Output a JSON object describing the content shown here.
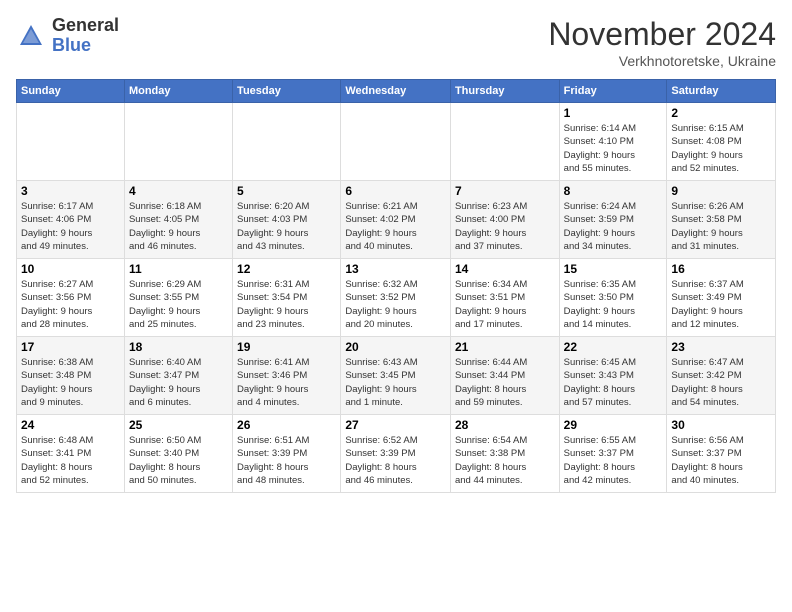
{
  "header": {
    "logo": {
      "general": "General",
      "blue": "Blue"
    },
    "title": "November 2024",
    "subtitle": "Verkhnotoretske, Ukraine"
  },
  "calendar": {
    "days_of_week": [
      "Sunday",
      "Monday",
      "Tuesday",
      "Wednesday",
      "Thursday",
      "Friday",
      "Saturday"
    ],
    "weeks": [
      [
        {
          "day": "",
          "info": ""
        },
        {
          "day": "",
          "info": ""
        },
        {
          "day": "",
          "info": ""
        },
        {
          "day": "",
          "info": ""
        },
        {
          "day": "",
          "info": ""
        },
        {
          "day": "1",
          "info": "Sunrise: 6:14 AM\nSunset: 4:10 PM\nDaylight: 9 hours\nand 55 minutes."
        },
        {
          "day": "2",
          "info": "Sunrise: 6:15 AM\nSunset: 4:08 PM\nDaylight: 9 hours\nand 52 minutes."
        }
      ],
      [
        {
          "day": "3",
          "info": "Sunrise: 6:17 AM\nSunset: 4:06 PM\nDaylight: 9 hours\nand 49 minutes."
        },
        {
          "day": "4",
          "info": "Sunrise: 6:18 AM\nSunset: 4:05 PM\nDaylight: 9 hours\nand 46 minutes."
        },
        {
          "day": "5",
          "info": "Sunrise: 6:20 AM\nSunset: 4:03 PM\nDaylight: 9 hours\nand 43 minutes."
        },
        {
          "day": "6",
          "info": "Sunrise: 6:21 AM\nSunset: 4:02 PM\nDaylight: 9 hours\nand 40 minutes."
        },
        {
          "day": "7",
          "info": "Sunrise: 6:23 AM\nSunset: 4:00 PM\nDaylight: 9 hours\nand 37 minutes."
        },
        {
          "day": "8",
          "info": "Sunrise: 6:24 AM\nSunset: 3:59 PM\nDaylight: 9 hours\nand 34 minutes."
        },
        {
          "day": "9",
          "info": "Sunrise: 6:26 AM\nSunset: 3:58 PM\nDaylight: 9 hours\nand 31 minutes."
        }
      ],
      [
        {
          "day": "10",
          "info": "Sunrise: 6:27 AM\nSunset: 3:56 PM\nDaylight: 9 hours\nand 28 minutes."
        },
        {
          "day": "11",
          "info": "Sunrise: 6:29 AM\nSunset: 3:55 PM\nDaylight: 9 hours\nand 25 minutes."
        },
        {
          "day": "12",
          "info": "Sunrise: 6:31 AM\nSunset: 3:54 PM\nDaylight: 9 hours\nand 23 minutes."
        },
        {
          "day": "13",
          "info": "Sunrise: 6:32 AM\nSunset: 3:52 PM\nDaylight: 9 hours\nand 20 minutes."
        },
        {
          "day": "14",
          "info": "Sunrise: 6:34 AM\nSunset: 3:51 PM\nDaylight: 9 hours\nand 17 minutes."
        },
        {
          "day": "15",
          "info": "Sunrise: 6:35 AM\nSunset: 3:50 PM\nDaylight: 9 hours\nand 14 minutes."
        },
        {
          "day": "16",
          "info": "Sunrise: 6:37 AM\nSunset: 3:49 PM\nDaylight: 9 hours\nand 12 minutes."
        }
      ],
      [
        {
          "day": "17",
          "info": "Sunrise: 6:38 AM\nSunset: 3:48 PM\nDaylight: 9 hours\nand 9 minutes."
        },
        {
          "day": "18",
          "info": "Sunrise: 6:40 AM\nSunset: 3:47 PM\nDaylight: 9 hours\nand 6 minutes."
        },
        {
          "day": "19",
          "info": "Sunrise: 6:41 AM\nSunset: 3:46 PM\nDaylight: 9 hours\nand 4 minutes."
        },
        {
          "day": "20",
          "info": "Sunrise: 6:43 AM\nSunset: 3:45 PM\nDaylight: 9 hours\nand 1 minute."
        },
        {
          "day": "21",
          "info": "Sunrise: 6:44 AM\nSunset: 3:44 PM\nDaylight: 8 hours\nand 59 minutes."
        },
        {
          "day": "22",
          "info": "Sunrise: 6:45 AM\nSunset: 3:43 PM\nDaylight: 8 hours\nand 57 minutes."
        },
        {
          "day": "23",
          "info": "Sunrise: 6:47 AM\nSunset: 3:42 PM\nDaylight: 8 hours\nand 54 minutes."
        }
      ],
      [
        {
          "day": "24",
          "info": "Sunrise: 6:48 AM\nSunset: 3:41 PM\nDaylight: 8 hours\nand 52 minutes."
        },
        {
          "day": "25",
          "info": "Sunrise: 6:50 AM\nSunset: 3:40 PM\nDaylight: 8 hours\nand 50 minutes."
        },
        {
          "day": "26",
          "info": "Sunrise: 6:51 AM\nSunset: 3:39 PM\nDaylight: 8 hours\nand 48 minutes."
        },
        {
          "day": "27",
          "info": "Sunrise: 6:52 AM\nSunset: 3:39 PM\nDaylight: 8 hours\nand 46 minutes."
        },
        {
          "day": "28",
          "info": "Sunrise: 6:54 AM\nSunset: 3:38 PM\nDaylight: 8 hours\nand 44 minutes."
        },
        {
          "day": "29",
          "info": "Sunrise: 6:55 AM\nSunset: 3:37 PM\nDaylight: 8 hours\nand 42 minutes."
        },
        {
          "day": "30",
          "info": "Sunrise: 6:56 AM\nSunset: 3:37 PM\nDaylight: 8 hours\nand 40 minutes."
        }
      ]
    ]
  }
}
